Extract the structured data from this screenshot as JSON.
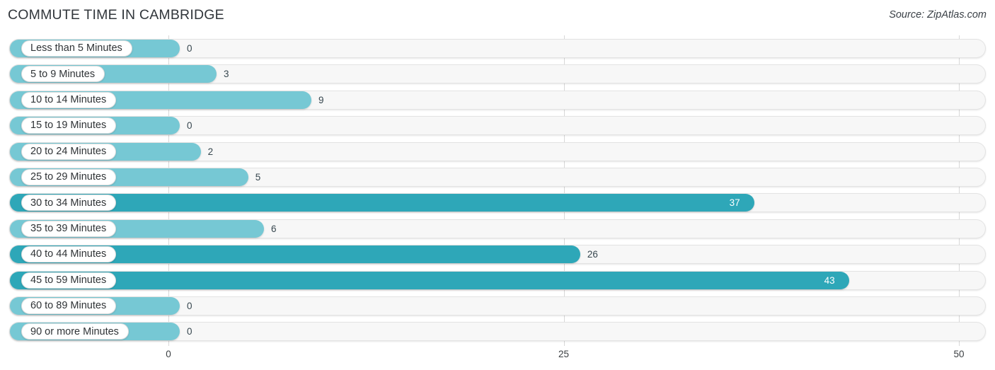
{
  "header": {
    "title": "COMMUTE TIME IN CAMBRIDGE",
    "source": "Source: ZipAtlas.com"
  },
  "colors": {
    "bar_light": "#76c8d4",
    "bar_dark": "#2ea7b8",
    "track": "#f7f7f7",
    "gridline": "#d8d8d8",
    "label_plate": "#ffffff",
    "value_inside": "#ffffff",
    "value_outside": "#37474f",
    "title": "#31363b"
  },
  "chart_data": {
    "type": "bar",
    "orientation": "horizontal",
    "title": "COMMUTE TIME IN CAMBRIDGE",
    "xlabel": "",
    "ylabel": "",
    "xlim": [
      0,
      50
    ],
    "grid": true,
    "legend": null,
    "xticks": [
      "0",
      "25",
      "50"
    ],
    "xtick_values": [
      0,
      25,
      50
    ],
    "categories": [
      "Less than 5 Minutes",
      "5 to 9 Minutes",
      "10 to 14 Minutes",
      "15 to 19 Minutes",
      "20 to 24 Minutes",
      "25 to 29 Minutes",
      "30 to 34 Minutes",
      "35 to 39 Minutes",
      "40 to 44 Minutes",
      "45 to 59 Minutes",
      "60 to 89 Minutes",
      "90 or more Minutes"
    ],
    "values": [
      0,
      3,
      9,
      0,
      2,
      5,
      37,
      6,
      26,
      43,
      0,
      0
    ],
    "value_labels": [
      "0",
      "3",
      "9",
      "0",
      "2",
      "5",
      "37",
      "6",
      "26",
      "43",
      "0",
      "0"
    ]
  },
  "rows": [
    {
      "label": "Less than 5 Minutes",
      "value": 0,
      "value_label": "0",
      "inside": false,
      "tone": "light"
    },
    {
      "label": "5 to 9 Minutes",
      "value": 3,
      "value_label": "3",
      "inside": false,
      "tone": "light"
    },
    {
      "label": "10 to 14 Minutes",
      "value": 9,
      "value_label": "9",
      "inside": false,
      "tone": "light"
    },
    {
      "label": "15 to 19 Minutes",
      "value": 0,
      "value_label": "0",
      "inside": false,
      "tone": "light"
    },
    {
      "label": "20 to 24 Minutes",
      "value": 2,
      "value_label": "2",
      "inside": false,
      "tone": "light"
    },
    {
      "label": "25 to 29 Minutes",
      "value": 5,
      "value_label": "5",
      "inside": false,
      "tone": "light"
    },
    {
      "label": "30 to 34 Minutes",
      "value": 37,
      "value_label": "37",
      "inside": true,
      "tone": "dark"
    },
    {
      "label": "35 to 39 Minutes",
      "value": 6,
      "value_label": "6",
      "inside": false,
      "tone": "light"
    },
    {
      "label": "40 to 44 Minutes",
      "value": 26,
      "value_label": "26",
      "inside": false,
      "tone": "dark"
    },
    {
      "label": "45 to 59 Minutes",
      "value": 43,
      "value_label": "43",
      "inside": true,
      "tone": "dark"
    },
    {
      "label": "60 to 89 Minutes",
      "value": 0,
      "value_label": "0",
      "inside": false,
      "tone": "light"
    },
    {
      "label": "90 or more Minutes",
      "value": 0,
      "value_label": "0",
      "inside": false,
      "tone": "light"
    }
  ],
  "axis": {
    "ticks": [
      {
        "label": "0",
        "value": 0
      },
      {
        "label": "25",
        "value": 25
      },
      {
        "label": "50",
        "value": 50
      }
    ]
  }
}
